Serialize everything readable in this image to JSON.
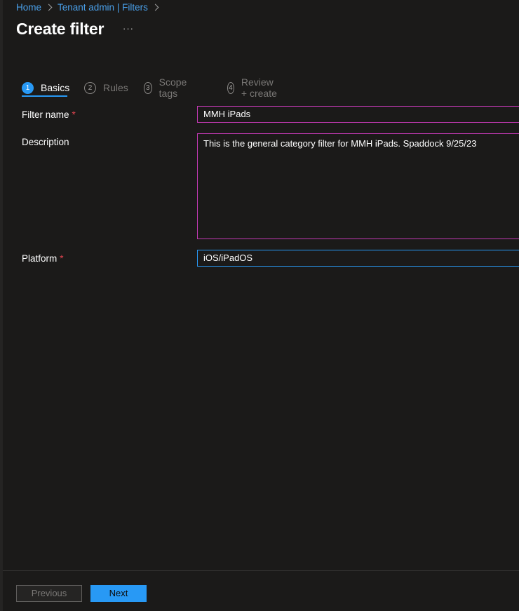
{
  "breadcrumb": {
    "items": [
      "Home",
      "Tenant admin | Filters"
    ]
  },
  "page": {
    "title": "Create filter",
    "more_label": "···"
  },
  "wizard": {
    "steps": [
      {
        "num": "1",
        "label": "Basics",
        "active": true
      },
      {
        "num": "2",
        "label": "Rules",
        "active": false
      },
      {
        "num": "3",
        "label": "Scope tags",
        "active": false
      },
      {
        "num": "4",
        "label": "Review + create",
        "active": false
      }
    ]
  },
  "form": {
    "filter_name": {
      "label": "Filter name",
      "required_mark": "*",
      "value": "MMH iPads"
    },
    "description": {
      "label": "Description",
      "value": "This is the general category filter for MMH iPads. Spaddock 9/25/23"
    },
    "platform": {
      "label": "Platform",
      "required_mark": "*",
      "value": "iOS/iPadOS"
    }
  },
  "footer": {
    "previous_label": "Previous",
    "next_label": "Next"
  },
  "colors": {
    "background": "#1b1a19",
    "accent": "#2899f5",
    "link": "#4aa0ea",
    "invalid_border": "#c239b3",
    "required": "#e0444f"
  }
}
